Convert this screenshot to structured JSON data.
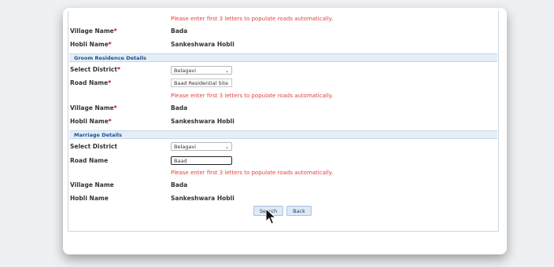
{
  "top": {
    "hint": "Please enter first 3 letters to populate roads automatically.",
    "village_label": "Village Name",
    "village_value": "Bada",
    "hobli_label": "Hobli Name",
    "hobli_value": "Sankeshwara Hobli"
  },
  "groom": {
    "section_title": "Groom Residence Details",
    "district_label": "Select District",
    "district_value": "Belagavi",
    "road_label": "Road Name",
    "road_value": "Baad Residential Site",
    "hint": "Please enter first 3 letters to populate roads automatically.",
    "village_label": "Village Name",
    "village_value": "Bada",
    "hobli_label": "Hobli Name",
    "hobli_value": "Sankeshwara Hobli"
  },
  "marriage": {
    "section_title": "Marriage Details",
    "district_label": "Select District",
    "district_value": "Belagavi",
    "road_label": "Road Name",
    "road_value": "Baad",
    "hint": "Please enter first 3 letters to populate roads automatically.",
    "village_label": "Village Name",
    "village_value": "Bada",
    "hobli_label": "Hobli Name",
    "hobli_value": "Sankeshwara Hobli"
  },
  "buttons": {
    "search": "Search",
    "back": "Back"
  },
  "required_marker": "*",
  "colors": {
    "hint": "#e0433a",
    "section_bg": "#e3eef9",
    "section_text": "#1f4e8c",
    "required": "#d40000"
  }
}
